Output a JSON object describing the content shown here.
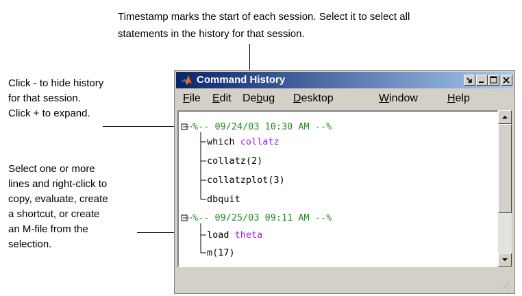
{
  "callouts": {
    "top_line1": "Timestamp marks the start of each session. Select it to select all",
    "top_line2": "statements in the history for that session.",
    "left1": [
      "Click - to hide history",
      "for that session.",
      "Click + to expand."
    ],
    "left2": [
      "Select one or more",
      "lines and right-click to",
      "copy, evaluate, create",
      "a shortcut, or create",
      "an M-file from the",
      "selection."
    ]
  },
  "window": {
    "title": "Command History",
    "icon": "matlab-logo-icon",
    "menu": [
      "File",
      "Edit",
      "Debug",
      "Desktop",
      "Window",
      "Help"
    ],
    "menu_mnemonics": [
      "F",
      "E",
      "b",
      "D",
      "W",
      "H"
    ]
  },
  "history": {
    "sessions": [
      {
        "expander": "⊟",
        "timestamp": "%-- 09/24/03 10:30 AM --%",
        "lines": [
          {
            "cmd": "which",
            "arg": "collatz"
          },
          {
            "cmd": "collatz(2)",
            "arg": ""
          },
          {
            "cmd": "collatzplot(3)",
            "arg": ""
          },
          {
            "cmd": "dbquit",
            "arg": ""
          }
        ]
      },
      {
        "expander": "⊟",
        "timestamp": "%-- 09/25/03 09:11 AM --%",
        "lines": [
          {
            "cmd": "load",
            "arg": "theta"
          },
          {
            "cmd": "m(17)",
            "arg": ""
          }
        ]
      }
    ]
  },
  "colors": {
    "timestamp": "#228b22",
    "string_arg": "#a020f0",
    "titlebar_start": "#0a246a",
    "titlebar_end": "#a6caf0"
  }
}
